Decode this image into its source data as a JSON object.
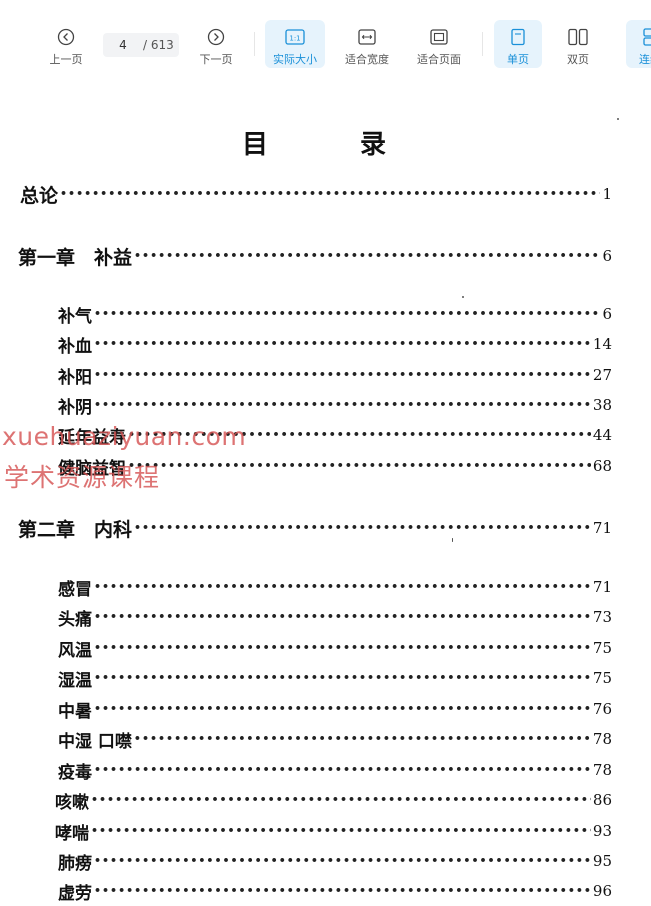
{
  "toolbar": {
    "prev_label": "上一页",
    "page_current": "4",
    "page_total": "/ 613",
    "next_label": "下一页",
    "actual_size_label": "实际大小",
    "actual_size_icon_text": "1:1",
    "fit_width_label": "适合宽度",
    "fit_page_label": "适合页面",
    "single_page_label": "单页",
    "double_page_label": "双页",
    "continuous_label": "连续",
    "accent_color": "#1a90d8"
  },
  "document": {
    "title_left": "目",
    "title_right": "录",
    "entries": [
      {
        "label": "总论",
        "page": "1",
        "level": "heading"
      },
      {
        "label": "第一章　补益",
        "page": "6",
        "level": "heading"
      },
      {
        "label": "补气",
        "page": "6",
        "level": "section"
      },
      {
        "label": "补血",
        "page": "14",
        "level": "section"
      },
      {
        "label": "补阳",
        "page": "27",
        "level": "section"
      },
      {
        "label": "补阴",
        "page": "38",
        "level": "section"
      },
      {
        "label": "延年益寿",
        "page": "44",
        "level": "section"
      },
      {
        "label": "健脑益智",
        "page": "68",
        "level": "section"
      },
      {
        "label": "第二章　内科",
        "page": "71",
        "level": "heading"
      },
      {
        "label": "感冒",
        "page": "71",
        "level": "section"
      },
      {
        "label": "头痛",
        "page": "73",
        "level": "section"
      },
      {
        "label": "风温",
        "page": "75",
        "level": "section"
      },
      {
        "label": "湿温",
        "page": "75",
        "level": "section"
      },
      {
        "label": "中暑",
        "page": "76",
        "level": "section"
      },
      {
        "label": "中湿 口噤",
        "page": "78",
        "level": "section"
      },
      {
        "label": "疫毒",
        "page": "78",
        "level": "section"
      },
      {
        "label": "咳嗽",
        "page": "86",
        "level": "section"
      },
      {
        "label": "哮喘",
        "page": "93",
        "level": "section"
      },
      {
        "label": "肺痨",
        "page": "95",
        "level": "section"
      },
      {
        "label": "虚劳",
        "page": "96",
        "level": "section"
      }
    ]
  },
  "watermark": {
    "line1": "xuehuaziyuan.com",
    "line2": "学术资源课程"
  }
}
